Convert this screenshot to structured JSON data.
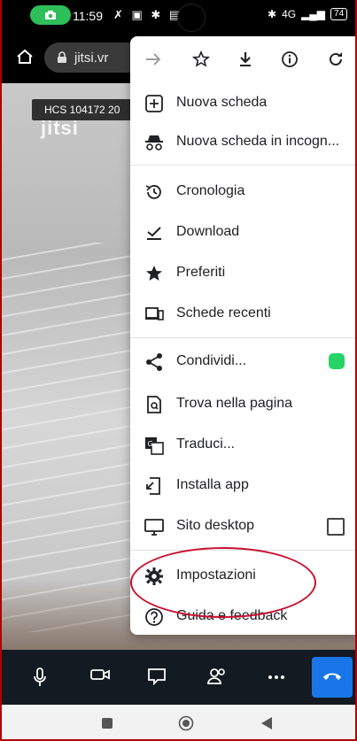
{
  "status_bar": {
    "time": "11:59",
    "icons": "✗ ▣ ✱ ▤",
    "network": "4G",
    "battery": "74"
  },
  "address_bar": {
    "url": "jitsi.vr"
  },
  "video": {
    "room_label": "HCS 104172 20",
    "watermark": "jitsi"
  },
  "menu": {
    "top_icons": [
      "forward-icon",
      "star-icon",
      "download-icon",
      "info-icon",
      "reload-icon"
    ],
    "items": [
      {
        "label": "Nuova scheda",
        "icon": "new-tab-icon"
      },
      {
        "label": "Nuova scheda in incogn...",
        "icon": "incognito-icon"
      },
      {
        "label": "Cronologia",
        "icon": "history-icon"
      },
      {
        "label": "Download",
        "icon": "download-check-icon"
      },
      {
        "label": "Preferiti",
        "icon": "star-filled-icon"
      },
      {
        "label": "Schede recenti",
        "icon": "recent-tabs-icon"
      },
      {
        "label": "Condividi...",
        "icon": "share-icon"
      },
      {
        "label": "Trova nella pagina",
        "icon": "find-icon"
      },
      {
        "label": "Traduci...",
        "icon": "translate-icon"
      },
      {
        "label": "Installa app",
        "icon": "install-icon"
      },
      {
        "label": "Sito desktop",
        "icon": "desktop-icon"
      },
      {
        "label": "Impostazioni",
        "icon": "gear-icon"
      },
      {
        "label": "Guida e feedback",
        "icon": "help-icon"
      }
    ]
  },
  "toolbar": {
    "icons": [
      "microphone-icon",
      "camera-icon",
      "screen-share-icon",
      "participants-icon",
      "more-icon",
      "hangup-icon"
    ]
  },
  "colors": {
    "accent_blue": "#1976e8",
    "whatsapp_green": "#25d366",
    "annotation_red": "#c8102e"
  }
}
